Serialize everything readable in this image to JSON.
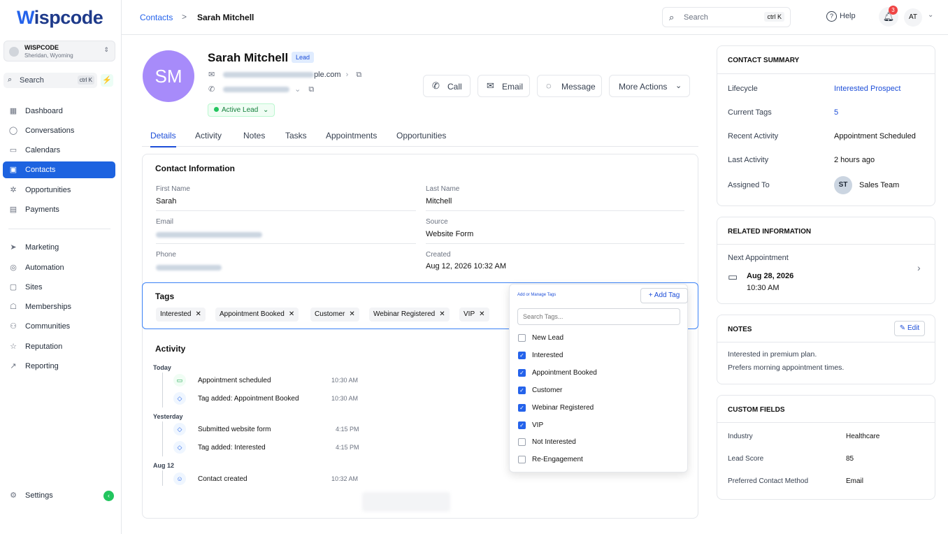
{
  "app": {
    "logo": "ispcode",
    "logo_mark": "W"
  },
  "location": {
    "name": "WISPCODE",
    "sub": "Sheridan, Wyoming"
  },
  "sidebar": {
    "search_placeholder": "Search",
    "search_kbd": "ctrl K",
    "items": [
      {
        "label": "Dashboard",
        "icon": "grid-icon"
      },
      {
        "label": "Conversations",
        "icon": "chat-icon"
      },
      {
        "label": "Calendars",
        "icon": "calendar-icon"
      },
      {
        "label": "Contacts",
        "icon": "contacts-icon"
      },
      {
        "label": "Opportunities",
        "icon": "opportunities-icon"
      },
      {
        "label": "Payments",
        "icon": "receipt-icon"
      },
      {
        "label": "Marketing",
        "icon": "send-icon"
      },
      {
        "label": "Automation",
        "icon": "automation-icon"
      },
      {
        "label": "Sites",
        "icon": "sites-icon"
      },
      {
        "label": "Memberships",
        "icon": "membership-icon"
      },
      {
        "label": "Communities",
        "icon": "communities-icon"
      },
      {
        "label": "Reputation",
        "icon": "star-icon"
      },
      {
        "label": "Reporting",
        "icon": "trend-icon"
      }
    ],
    "settings": "Settings"
  },
  "topbar": {
    "breadcrumb_root": "Contacts",
    "breadcrumb_sep": ">",
    "breadcrumb_current": "Sarah Mitchell",
    "search_placeholder": "Search",
    "search_kbd": "ctrl K",
    "help": "Help",
    "notif_count": "3",
    "user_initials": "AT"
  },
  "contact": {
    "initials": "SM",
    "name": "Sarah Mitchell",
    "badge": "Lead",
    "email_suffix": "ple.com",
    "status": "Active Lead"
  },
  "actions": {
    "call": "Call",
    "email": "Email",
    "message": "Message",
    "more": "More Actions"
  },
  "tabs": [
    "Details",
    "Activity",
    "Notes",
    "Tasks",
    "Appointments",
    "Opportunities"
  ],
  "contact_info": {
    "title": "Contact Information",
    "first_name_label": "First Name",
    "first_name": "Sarah",
    "last_name_label": "Last Name",
    "last_name": "Mitchell",
    "email_label": "Email",
    "source_label": "Source",
    "source": "Website Form",
    "phone_label": "Phone",
    "created_label": "Created",
    "created": "Aug 12, 2026 10:32 AM"
  },
  "tags": {
    "title": "Tags",
    "chips": [
      "Interested",
      "Appointment Booked",
      "Customer",
      "Webinar Registered",
      "VIP"
    ]
  },
  "tag_dropdown": {
    "title": "Add or Manage Tags",
    "add_tag": "Add Tag",
    "search_placeholder": "Search Tags...",
    "options": [
      {
        "label": "New Lead",
        "checked": false
      },
      {
        "label": "Interested",
        "checked": true
      },
      {
        "label": "Appointment Booked",
        "checked": true
      },
      {
        "label": "Customer",
        "checked": true
      },
      {
        "label": "Webinar Registered",
        "checked": true
      },
      {
        "label": "VIP",
        "checked": true
      },
      {
        "label": "Not Interested",
        "checked": false
      },
      {
        "label": "Re-Engagement",
        "checked": false
      }
    ]
  },
  "activity": {
    "title": "Activity",
    "groups": [
      {
        "day": "Today",
        "items": [
          {
            "text": "Appointment scheduled",
            "time": "10:30 AM",
            "icon": "calendar-icon"
          },
          {
            "text": "Tag added: Appointment Booked",
            "time": "10:30 AM",
            "icon": "tag-icon"
          }
        ]
      },
      {
        "day": "Yesterday",
        "items": [
          {
            "text": "Submitted website form",
            "time": "4:15 PM",
            "icon": "tag-icon"
          },
          {
            "text": "Tag added: Interested",
            "time": "4:15 PM",
            "icon": "tag-icon"
          }
        ]
      },
      {
        "day": "Aug 12",
        "items": [
          {
            "text": "Contact created",
            "time": "10:32 AM",
            "icon": "user-icon"
          }
        ]
      }
    ]
  },
  "summary": {
    "title": "CONTACT SUMMARY",
    "lifecycle_label": "Lifecycle",
    "lifecycle": "Interested Prospect",
    "tags_label": "Current Tags",
    "tags": "5",
    "recent_label": "Recent Activity",
    "recent": "Appointment Scheduled",
    "last_label": "Last Activity",
    "last": "2 hours ago",
    "assigned_label": "Assigned To",
    "assigned_initials": "ST",
    "assigned": "Sales Team"
  },
  "related": {
    "title": "RELATED INFORMATION",
    "next_label": "Next Appointment",
    "date": "Aug 28, 2026",
    "time": "10:30 AM"
  },
  "notes": {
    "title": "NOTES",
    "edit": "Edit",
    "line1": "Interested in premium plan.",
    "line2": "Prefers morning appointment times."
  },
  "custom_fields": {
    "title": "CUSTOM FIELDS",
    "rows": [
      {
        "label": "Industry",
        "value": "Healthcare"
      },
      {
        "label": "Lead Score",
        "value": "85"
      },
      {
        "label": "Preferred Contact Method",
        "value": "Email"
      }
    ]
  },
  "colors": {
    "accent": "#1d63e0",
    "avatar": "#a78bfa",
    "success": "#22c55e",
    "danger": "#ef4444"
  }
}
